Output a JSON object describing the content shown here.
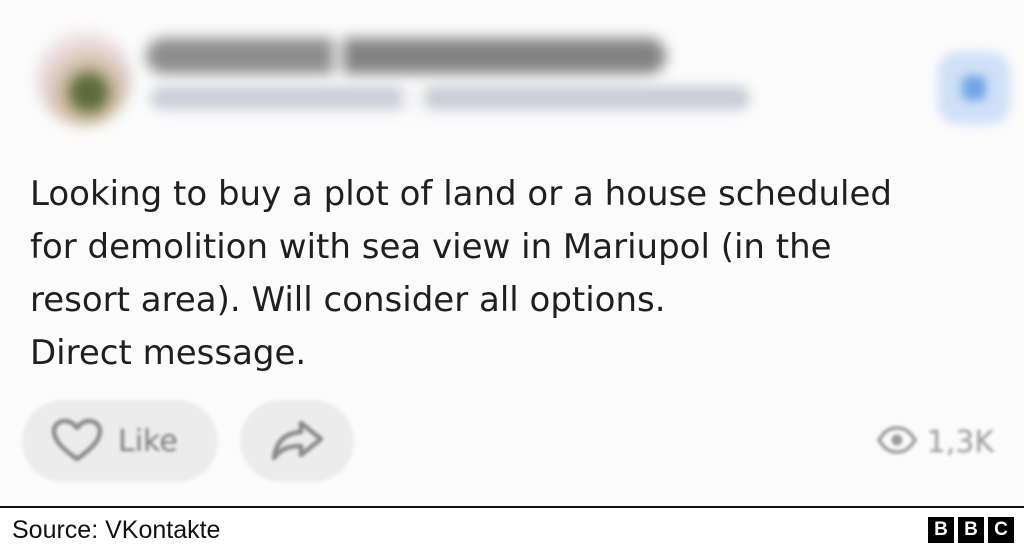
{
  "post": {
    "text_lines": [
      "Looking to buy a plot of land or a house scheduled",
      "for demolition with sea view in Mariupol (in the",
      "resort area). Will consider all options.",
      "Direct message."
    ],
    "like_label": "Like",
    "views_count": "1,3K",
    "icons": {
      "like": "heart-icon",
      "share": "share-arrow-icon",
      "views": "eye-icon"
    }
  },
  "footer": {
    "source": "Source: VKontakte",
    "logo_letters": [
      "B",
      "B",
      "C"
    ]
  },
  "colors": {
    "text": "#1f1f1f",
    "muted": "#7b7b7b",
    "button_bg": "#ececec",
    "follow_blue": "#cfe0f7"
  }
}
